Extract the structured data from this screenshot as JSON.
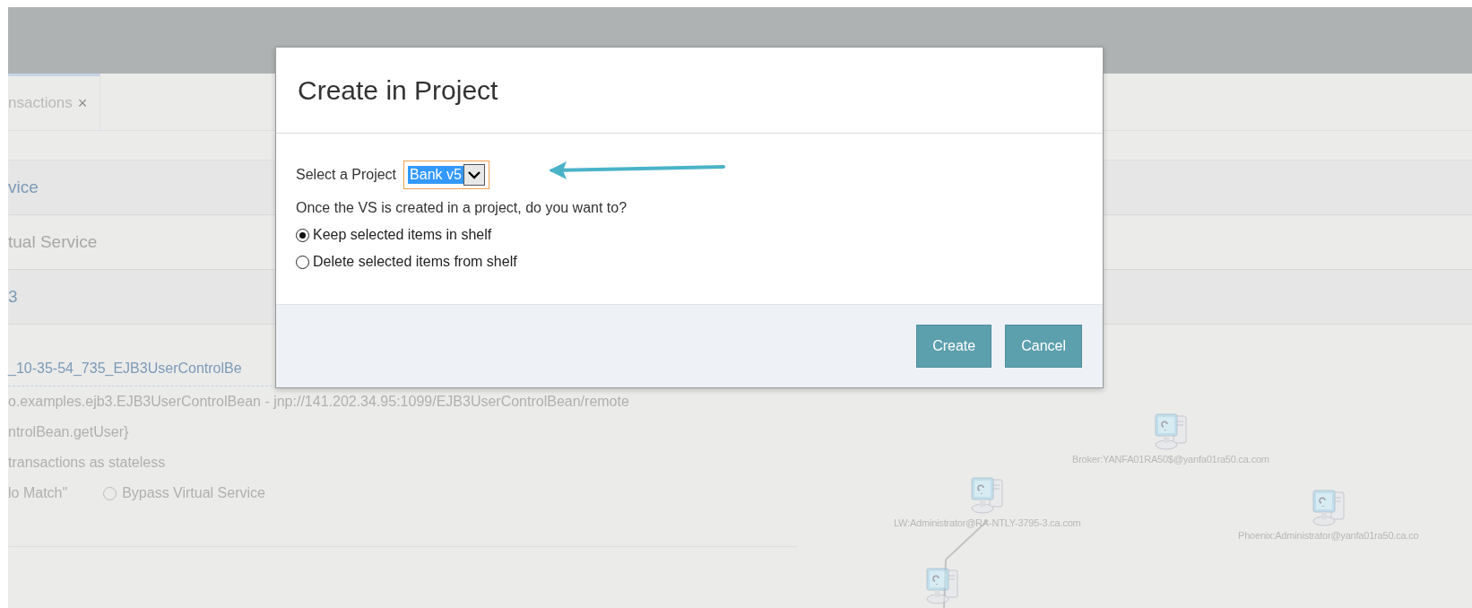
{
  "tabs": [
    {
      "label": "nsactions",
      "close": "×",
      "selected": true
    }
  ],
  "sections": [
    {
      "label": "vice",
      "kind": "link"
    },
    {
      "label": "tual Service",
      "kind": "plain"
    },
    {
      "label": "3",
      "kind": "link"
    }
  ],
  "details": {
    "service_link": "_10-35-54_735_EJB3UserControlBe",
    "lines": [
      "o.examples.ejb3.EJB3UserControlBean - jnp://141.202.34.95:1099/EJB3UserControlBean/remote",
      "ntrolBean.getUser}",
      "transactions as stateless"
    ],
    "mode_text": "lo Match\"",
    "mode_option": {
      "label": "Bypass Virtual Service",
      "selected": false
    }
  },
  "topology": {
    "nodes": [
      {
        "label": "Broker:YANFA01RA50$@yanfa01ra50.ca.com"
      },
      {
        "label": "LW:Administrator@RA-NTLY-3795-3.ca.com"
      },
      {
        "label": "Phoenix:Administrator@yanfa01ra50.ca.co"
      }
    ]
  },
  "dialog": {
    "title": "Create in Project",
    "project_label": "Select a Project",
    "project_value": "Bank v5",
    "question": "Once the VS is created in a project, do you want to?",
    "options": [
      {
        "label": "Keep selected items in shelf",
        "selected": true
      },
      {
        "label": "Delete selected items from shelf",
        "selected": false
      }
    ],
    "buttons": [
      {
        "label": "Create"
      },
      {
        "label": "Cancel"
      }
    ]
  }
}
